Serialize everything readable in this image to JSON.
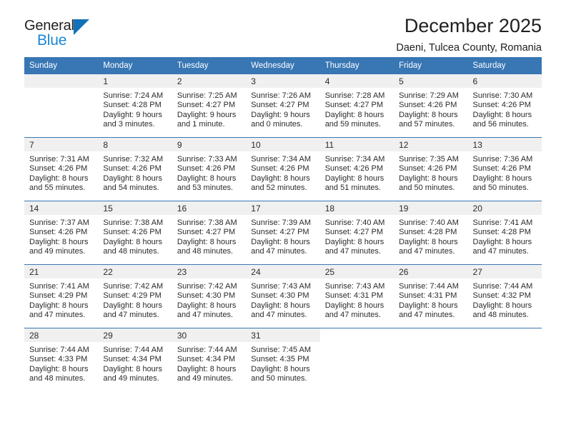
{
  "brand": {
    "name_part1": "General",
    "name_part2": "Blue",
    "triangle_color": "#1371b8",
    "blue_color": "#1c86d4"
  },
  "header": {
    "title": "December 2025",
    "subtitle": "Daeni, Tulcea County, Romania"
  },
  "calendar": {
    "header_bg": "#3876b4",
    "daynum_bg": "#f0f0f0",
    "weekdays": [
      "Sunday",
      "Monday",
      "Tuesday",
      "Wednesday",
      "Thursday",
      "Friday",
      "Saturday"
    ],
    "weeks": [
      [
        {
          "day": "",
          "lines": []
        },
        {
          "day": "1",
          "lines": [
            "Sunrise: 7:24 AM",
            "Sunset: 4:28 PM",
            "Daylight: 9 hours",
            "and 3 minutes."
          ]
        },
        {
          "day": "2",
          "lines": [
            "Sunrise: 7:25 AM",
            "Sunset: 4:27 PM",
            "Daylight: 9 hours",
            "and 1 minute."
          ]
        },
        {
          "day": "3",
          "lines": [
            "Sunrise: 7:26 AM",
            "Sunset: 4:27 PM",
            "Daylight: 9 hours",
            "and 0 minutes."
          ]
        },
        {
          "day": "4",
          "lines": [
            "Sunrise: 7:28 AM",
            "Sunset: 4:27 PM",
            "Daylight: 8 hours",
            "and 59 minutes."
          ]
        },
        {
          "day": "5",
          "lines": [
            "Sunrise: 7:29 AM",
            "Sunset: 4:26 PM",
            "Daylight: 8 hours",
            "and 57 minutes."
          ]
        },
        {
          "day": "6",
          "lines": [
            "Sunrise: 7:30 AM",
            "Sunset: 4:26 PM",
            "Daylight: 8 hours",
            "and 56 minutes."
          ]
        }
      ],
      [
        {
          "day": "7",
          "lines": [
            "Sunrise: 7:31 AM",
            "Sunset: 4:26 PM",
            "Daylight: 8 hours",
            "and 55 minutes."
          ]
        },
        {
          "day": "8",
          "lines": [
            "Sunrise: 7:32 AM",
            "Sunset: 4:26 PM",
            "Daylight: 8 hours",
            "and 54 minutes."
          ]
        },
        {
          "day": "9",
          "lines": [
            "Sunrise: 7:33 AM",
            "Sunset: 4:26 PM",
            "Daylight: 8 hours",
            "and 53 minutes."
          ]
        },
        {
          "day": "10",
          "lines": [
            "Sunrise: 7:34 AM",
            "Sunset: 4:26 PM",
            "Daylight: 8 hours",
            "and 52 minutes."
          ]
        },
        {
          "day": "11",
          "lines": [
            "Sunrise: 7:34 AM",
            "Sunset: 4:26 PM",
            "Daylight: 8 hours",
            "and 51 minutes."
          ]
        },
        {
          "day": "12",
          "lines": [
            "Sunrise: 7:35 AM",
            "Sunset: 4:26 PM",
            "Daylight: 8 hours",
            "and 50 minutes."
          ]
        },
        {
          "day": "13",
          "lines": [
            "Sunrise: 7:36 AM",
            "Sunset: 4:26 PM",
            "Daylight: 8 hours",
            "and 50 minutes."
          ]
        }
      ],
      [
        {
          "day": "14",
          "lines": [
            "Sunrise: 7:37 AM",
            "Sunset: 4:26 PM",
            "Daylight: 8 hours",
            "and 49 minutes."
          ]
        },
        {
          "day": "15",
          "lines": [
            "Sunrise: 7:38 AM",
            "Sunset: 4:26 PM",
            "Daylight: 8 hours",
            "and 48 minutes."
          ]
        },
        {
          "day": "16",
          "lines": [
            "Sunrise: 7:38 AM",
            "Sunset: 4:27 PM",
            "Daylight: 8 hours",
            "and 48 minutes."
          ]
        },
        {
          "day": "17",
          "lines": [
            "Sunrise: 7:39 AM",
            "Sunset: 4:27 PM",
            "Daylight: 8 hours",
            "and 47 minutes."
          ]
        },
        {
          "day": "18",
          "lines": [
            "Sunrise: 7:40 AM",
            "Sunset: 4:27 PM",
            "Daylight: 8 hours",
            "and 47 minutes."
          ]
        },
        {
          "day": "19",
          "lines": [
            "Sunrise: 7:40 AM",
            "Sunset: 4:28 PM",
            "Daylight: 8 hours",
            "and 47 minutes."
          ]
        },
        {
          "day": "20",
          "lines": [
            "Sunrise: 7:41 AM",
            "Sunset: 4:28 PM",
            "Daylight: 8 hours",
            "and 47 minutes."
          ]
        }
      ],
      [
        {
          "day": "21",
          "lines": [
            "Sunrise: 7:41 AM",
            "Sunset: 4:29 PM",
            "Daylight: 8 hours",
            "and 47 minutes."
          ]
        },
        {
          "day": "22",
          "lines": [
            "Sunrise: 7:42 AM",
            "Sunset: 4:29 PM",
            "Daylight: 8 hours",
            "and 47 minutes."
          ]
        },
        {
          "day": "23",
          "lines": [
            "Sunrise: 7:42 AM",
            "Sunset: 4:30 PM",
            "Daylight: 8 hours",
            "and 47 minutes."
          ]
        },
        {
          "day": "24",
          "lines": [
            "Sunrise: 7:43 AM",
            "Sunset: 4:30 PM",
            "Daylight: 8 hours",
            "and 47 minutes."
          ]
        },
        {
          "day": "25",
          "lines": [
            "Sunrise: 7:43 AM",
            "Sunset: 4:31 PM",
            "Daylight: 8 hours",
            "and 47 minutes."
          ]
        },
        {
          "day": "26",
          "lines": [
            "Sunrise: 7:44 AM",
            "Sunset: 4:31 PM",
            "Daylight: 8 hours",
            "and 47 minutes."
          ]
        },
        {
          "day": "27",
          "lines": [
            "Sunrise: 7:44 AM",
            "Sunset: 4:32 PM",
            "Daylight: 8 hours",
            "and 48 minutes."
          ]
        }
      ],
      [
        {
          "day": "28",
          "lines": [
            "Sunrise: 7:44 AM",
            "Sunset: 4:33 PM",
            "Daylight: 8 hours",
            "and 48 minutes."
          ]
        },
        {
          "day": "29",
          "lines": [
            "Sunrise: 7:44 AM",
            "Sunset: 4:34 PM",
            "Daylight: 8 hours",
            "and 49 minutes."
          ]
        },
        {
          "day": "30",
          "lines": [
            "Sunrise: 7:44 AM",
            "Sunset: 4:34 PM",
            "Daylight: 8 hours",
            "and 49 minutes."
          ]
        },
        {
          "day": "31",
          "lines": [
            "Sunrise: 7:45 AM",
            "Sunset: 4:35 PM",
            "Daylight: 8 hours",
            "and 50 minutes."
          ]
        },
        {
          "day": "",
          "lines": []
        },
        {
          "day": "",
          "lines": []
        },
        {
          "day": "",
          "lines": []
        }
      ]
    ]
  }
}
